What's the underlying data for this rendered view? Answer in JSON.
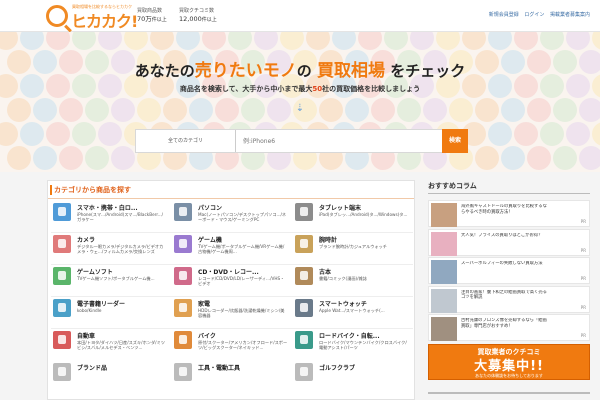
{
  "header": {
    "logo_tagline": "買取相場を比較するならヒカカク",
    "logo_name": "ヒカカク!",
    "stats": [
      {
        "label": "買取商品数",
        "value": "70万",
        "unit": "件以上"
      },
      {
        "label": "買取クチコミ数",
        "value": "12,000",
        "unit": "件以上"
      }
    ],
    "links": [
      "新規会員登録",
      "ログイン",
      "掲載業者募集案内"
    ]
  },
  "hero": {
    "headline_pre": "あなたの",
    "headline_em1": "売りたいモノ",
    "headline_mid": "の",
    "headline_em2": "買取相場",
    "headline_post": "をチェック",
    "sub_pre": "商品名を検索して、大手から中小まで最大",
    "sub_num": "50",
    "sub_post": "社の買取価格を比較しましょう",
    "arrow": "⇣"
  },
  "search": {
    "category_label": "全てのカテゴリ",
    "placeholder": "例:iPhone6",
    "button_label": "検索"
  },
  "categories_panel": {
    "title": "カテゴリから商品を探す",
    "items": [
      {
        "name": "スマホ・携帯・白ロ...",
        "desc": "iPhone(スマ.../Android(スマ.../BlackBerr.../ガラケー",
        "color": "#4f9bd8"
      },
      {
        "name": "パソコン",
        "desc": "Mac(ノートパソコン/デスクトップパソコ.../ネーボード・マウス/ゲーミングPC",
        "color": "#7a8fa6"
      },
      {
        "name": "タブレット端末",
        "desc": "iPad(タブレッ.../Android(タ.../Windows(タ...",
        "color": "#8c8c8c"
      },
      {
        "name": "カメラ",
        "desc": "デジタル一眼カメラ/デジタルカメラ/ビデオカメラ・ウェ.../フィルムカメラ/交換レンズ",
        "color": "#e07a7a"
      },
      {
        "name": "ゲーム機",
        "desc": "TVゲーム機/ポータブルゲーム機/VRゲーム機/古物機/ゲーム機周...",
        "color": "#9a7ad0"
      },
      {
        "name": "腕時計",
        "desc": "ブランド腕時計/カジュアルウォッチ",
        "color": "#c9a25a"
      },
      {
        "name": "ゲームソフト",
        "desc": "TVゲーム機ソフト/ポータブルゲーム機...",
        "color": "#5ab56a"
      },
      {
        "name": "CD・DVD・レコー...",
        "desc": "レコード/CD/DVD/LD/レーザーディ.../VHS・ビデオ",
        "color": "#d06a8a"
      },
      {
        "name": "古本",
        "desc": "書籍/コミック(漫画)/雑誌",
        "color": "#b08a5a"
      },
      {
        "name": "電子書籍リーダー",
        "desc": "kobo/Kindle",
        "color": "#4aa0c8"
      },
      {
        "name": "家電",
        "desc": "HDDレコーダー/炊飯器/洗濯乾燥機/ミシン/美容機器",
        "color": "#e0a050"
      },
      {
        "name": "スマートウォッチ",
        "desc": "Apple Wat.../スマートウォッチ(...",
        "color": "#6a7a8a"
      },
      {
        "name": "自動車",
        "desc": "本田/トヨタ/ダイハツ/日産/スズキ/ホンダ/ミツビシ/スバル/メルセデス・ベンツ...",
        "color": "#d85a5a"
      },
      {
        "name": "バイク",
        "desc": "原付/スクーター/アメリカン/オフロード/スポーツ/ビッグスクーター/ネイキッド...",
        "color": "#e08a3a"
      },
      {
        "name": "ロードバイク・自転...",
        "desc": "ロードバイク/マウンテンバイク/クロスバイク/電動アシスト/パーツ",
        "color": "#3a9a8a"
      }
    ],
    "next_row": [
      "ブランド品",
      "工具・電動工具",
      "ゴルフクラブ"
    ]
  },
  "sidebar": {
    "title": "おすすめコラム",
    "columns": [
      {
        "text": "海外風キャストドールの買取りを比較するならやるべき時の買取方法！",
        "color": "#c8a080"
      },
      {
        "text": "大人気！プライズの買取りはどこがお得？",
        "color": "#e8b0c0"
      },
      {
        "text": "スーパーボルフィーの失敗しない買取方法",
        "color": "#90a8c0"
      },
      {
        "text": "注目の画家！腹下和之の絵画買取で高く売るコツを解説",
        "color": "#c0c8d0"
      },
      {
        "text": "古村充康のブロンズ像を売却するなら「絵画買取」専門店がおすすめ！",
        "color": "#a09080"
      }
    ],
    "pr_label": "PR",
    "banner": {
      "line1": "買取業者のクチコミ",
      "line2": "大募集中!!",
      "line3": "あなたの体験談をお待ちしております"
    }
  }
}
